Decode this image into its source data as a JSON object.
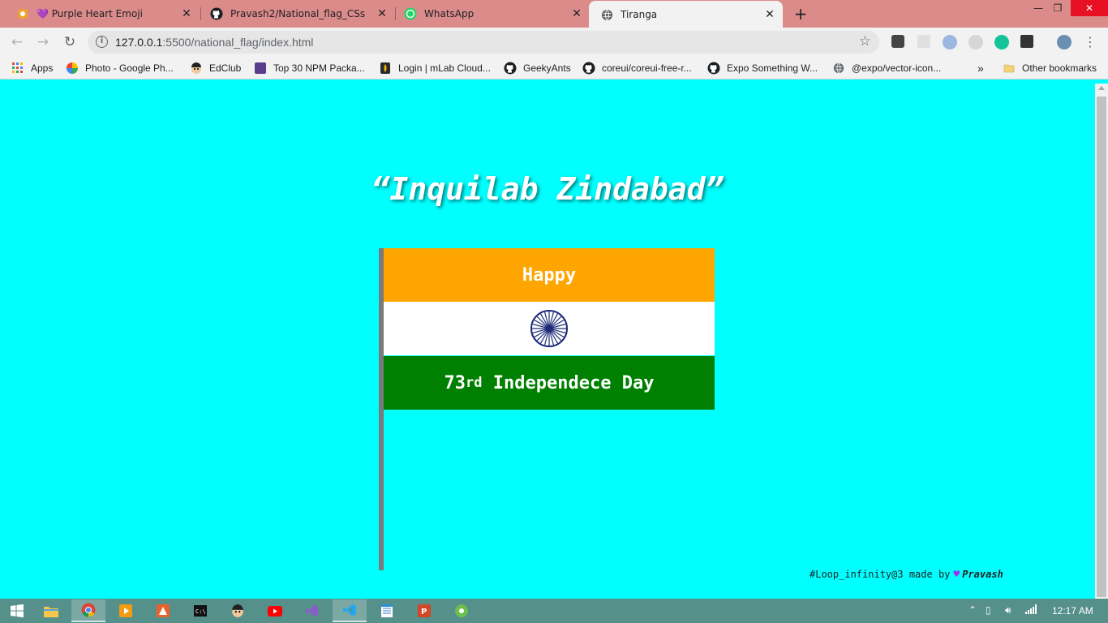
{
  "browser": {
    "tabs": [
      {
        "title": "💜 Purple Heart Emoji",
        "icon": "emojipedia-icon",
        "active": false
      },
      {
        "title": "Pravash2/National_flag_CSs",
        "icon": "github-icon",
        "active": false
      },
      {
        "title": "WhatsApp",
        "icon": "whatsapp-icon",
        "active": false
      },
      {
        "title": "Tiranga",
        "icon": "globe-icon",
        "active": true
      }
    ],
    "url_host": "127.0.0.1",
    "url_rest": ":5500/national_flag/index.html",
    "bookmarks": [
      {
        "label": "Apps",
        "icon": "apps-grid-icon"
      },
      {
        "label": "Photo - Google Ph...",
        "icon": "google-photos-icon"
      },
      {
        "label": "EdClub",
        "icon": "edclub-icon"
      },
      {
        "label": "Top 30 NPM Packa...",
        "icon": "colorlib-icon"
      },
      {
        "label": "Login | mLab Cloud...",
        "icon": "mlab-icon"
      },
      {
        "label": "GeekyAnts",
        "icon": "github-icon"
      },
      {
        "label": "coreui/coreui-free-r...",
        "icon": "github-icon"
      },
      {
        "label": "Expo Something W...",
        "icon": "github-icon"
      },
      {
        "label": "@expo/vector-icon...",
        "icon": "globe-icon"
      }
    ],
    "overflow": "»",
    "other_bookmarks": "Other bookmarks"
  },
  "page": {
    "headline": "“Inquilab Zindabad”",
    "flag_top_text": "Happy",
    "flag_bottom_number": "73",
    "flag_bottom_suffix": "rd",
    "flag_bottom_text": " Independece Day",
    "footer_prefix": "#Loop_infinity@3 made by",
    "footer_author": "Pravash"
  },
  "colors": {
    "page_bg": "#00ffff",
    "saffron": "#ffa500",
    "white": "#ffffff",
    "green": "#008000",
    "chakra": "#1c2a78",
    "heart": "#9b2ff0"
  },
  "taskbar": {
    "time": "12:17 AM"
  }
}
